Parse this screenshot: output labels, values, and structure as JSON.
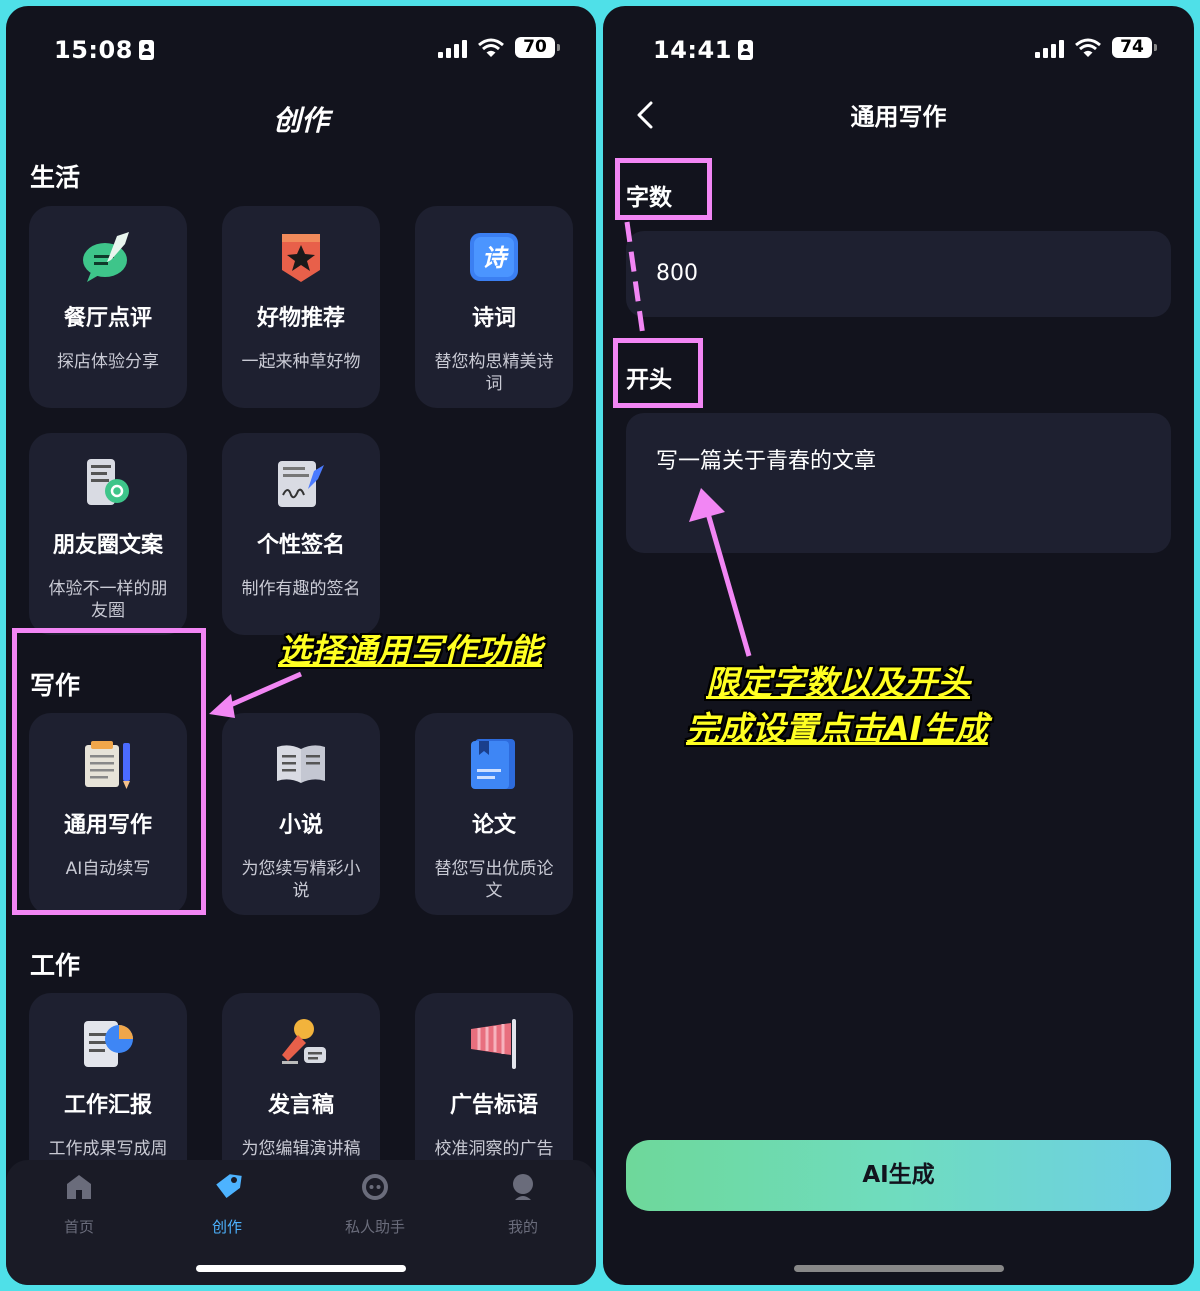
{
  "left": {
    "time": "15:08",
    "battery": "70",
    "page_title": "创作",
    "sections": {
      "life": {
        "title": "生活",
        "cards": [
          {
            "title": "餐厅点评",
            "desc": "探店体验分享",
            "icon": "review-chat-icon"
          },
          {
            "title": "好物推荐",
            "desc": "一起来种草好物",
            "icon": "star-badge-icon"
          },
          {
            "title": "诗词",
            "desc": "替您构思精美诗词",
            "icon": "poem-icon"
          },
          {
            "title": "朋友圈文案",
            "desc": "体验不一样的朋友圈",
            "icon": "phone-moments-icon"
          },
          {
            "title": "个性签名",
            "desc": "制作有趣的签名",
            "icon": "signature-icon"
          }
        ]
      },
      "writing": {
        "title": "写作",
        "cards": [
          {
            "title": "通用写作",
            "desc": "AI自动续写",
            "icon": "notepad-pencil-icon"
          },
          {
            "title": "小说",
            "desc": "为您续写精彩小说",
            "icon": "open-book-icon"
          },
          {
            "title": "论文",
            "desc": "替您写出优质论文",
            "icon": "paper-book-icon"
          }
        ]
      },
      "work": {
        "title": "工作",
        "cards": [
          {
            "title": "工作汇报",
            "desc": "工作成果写成周报、日报",
            "icon": "report-chart-icon"
          },
          {
            "title": "发言稿",
            "desc": "为您编辑演讲稿",
            "icon": "microphone-icon"
          },
          {
            "title": "广告标语",
            "desc": "校准洞察的广告语",
            "icon": "banner-flag-icon"
          }
        ]
      }
    },
    "tabs": [
      {
        "label": "首页",
        "icon": "home-icon"
      },
      {
        "label": "创作",
        "icon": "tag-icon"
      },
      {
        "label": "私人助手",
        "icon": "assistant-icon"
      },
      {
        "label": "我的",
        "icon": "profile-icon"
      }
    ],
    "annotation": "选择通用写作功能"
  },
  "right": {
    "time": "14:41",
    "battery": "74",
    "page_title": "通用写作",
    "word_count_label": "字数",
    "word_count_value": "800",
    "opening_label": "开头",
    "opening_value": "写一篇关于青春的文章",
    "annotation_line1": "限定字数以及开头",
    "annotation_line2": "完成设置点击AI生成",
    "ai_button": "AI生成"
  },
  "colors": {
    "background": "#12131d",
    "card": "#1e2030",
    "accent_tab": "#4db3ff",
    "highlight": "#f286f4",
    "annotation": "#ffff22",
    "border": "#4fe0e8"
  }
}
